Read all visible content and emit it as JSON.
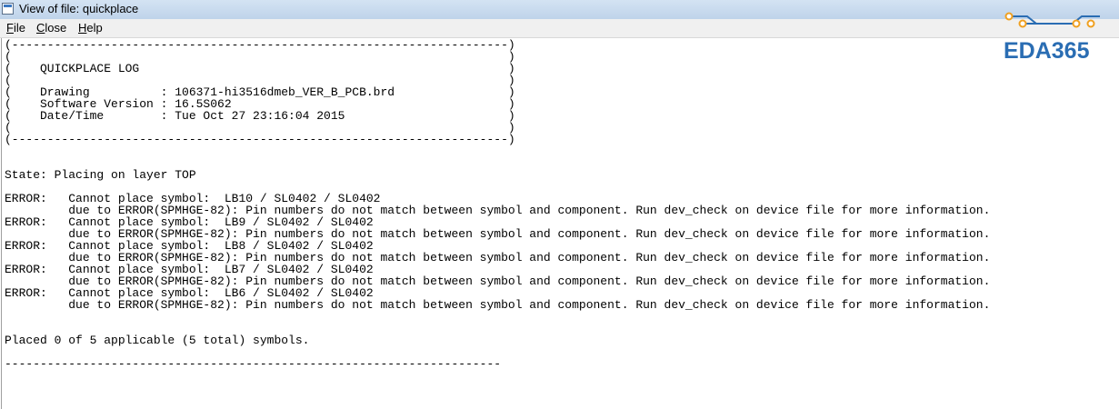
{
  "window": {
    "title": "View of file: quickplace"
  },
  "menu": {
    "items": [
      {
        "mnemonic": "F",
        "rest": "ile"
      },
      {
        "mnemonic": "C",
        "rest": "lose"
      },
      {
        "mnemonic": "H",
        "rest": "elp"
      }
    ]
  },
  "watermark": {
    "text": "EDA365",
    "color": "#2a6db3",
    "accent_color": "#f0a020"
  },
  "log": {
    "lines": [
      "(----------------------------------------------------------------------)",
      "(                                                                      )",
      "(    QUICKPLACE LOG                                                    )",
      "(                                                                      )",
      "(    Drawing          : 106371-hi3516dmeb_VER_B_PCB.brd                )",
      "(    Software Version : 16.5S062                                       )",
      "(    Date/Time        : Tue Oct 27 23:16:04 2015                       )",
      "(                                                                      )",
      "(----------------------------------------------------------------------)",
      "",
      "",
      "State: Placing on layer TOP",
      "",
      "ERROR:   Cannot place symbol:  LB10 / SL0402 / SL0402",
      "         due to ERROR(SPMHGE-82): Pin numbers do not match between symbol and component. Run dev_check on device file for more information.",
      "ERROR:   Cannot place symbol:  LB9 / SL0402 / SL0402",
      "         due to ERROR(SPMHGE-82): Pin numbers do not match between symbol and component. Run dev_check on device file for more information.",
      "ERROR:   Cannot place symbol:  LB8 / SL0402 / SL0402",
      "         due to ERROR(SPMHGE-82): Pin numbers do not match between symbol and component. Run dev_check on device file for more information.",
      "ERROR:   Cannot place symbol:  LB7 / SL0402 / SL0402",
      "         due to ERROR(SPMHGE-82): Pin numbers do not match between symbol and component. Run dev_check on device file for more information.",
      "ERROR:   Cannot place symbol:  LB6 / SL0402 / SL0402",
      "         due to ERROR(SPMHGE-82): Pin numbers do not match between symbol and component. Run dev_check on device file for more information.",
      "",
      "",
      "Placed 0 of 5 applicable (5 total) symbols.",
      "",
      "----------------------------------------------------------------------"
    ]
  }
}
